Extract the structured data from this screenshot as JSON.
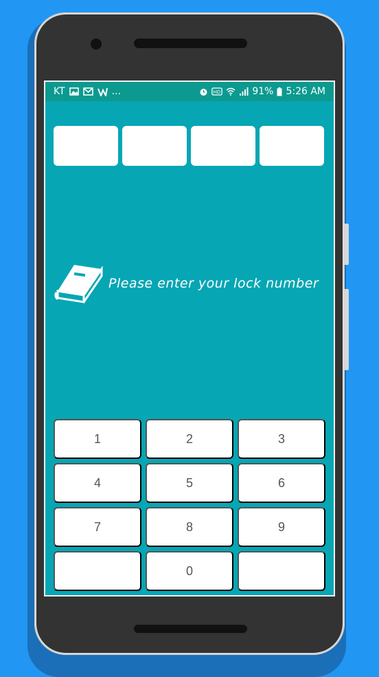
{
  "status_bar": {
    "carrier": "KT",
    "more": "...",
    "battery": "91%",
    "time": "5:26 AM",
    "icons": [
      "image-icon",
      "gmail-icon",
      "vscode-icon",
      "alarm-icon",
      "hd-icon",
      "wifi-icon",
      "signal-icon",
      "battery-icon"
    ]
  },
  "lock": {
    "prompt": "Please enter your lock number",
    "code_slots": 4
  },
  "keypad": {
    "keys": [
      "1",
      "2",
      "3",
      "4",
      "5",
      "6",
      "7",
      "8",
      "9",
      "",
      "0",
      ""
    ]
  },
  "colors": {
    "background": "#2196f3",
    "screen": "#06a6b4",
    "statusbar": "#0c9a90",
    "key": "#ffffff"
  }
}
